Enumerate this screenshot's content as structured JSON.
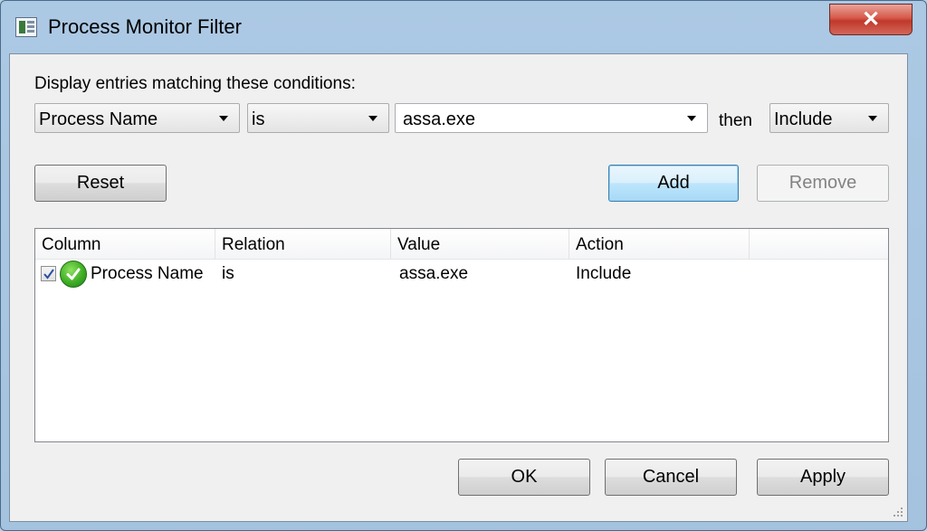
{
  "window": {
    "title": "Process Monitor Filter",
    "close_label": "✕"
  },
  "conditions": {
    "label": "Display entries matching these conditions:",
    "column_select": "Process Name",
    "relation_select": "is",
    "value_input": "assa.exe",
    "then_label": "then",
    "action_select": "Include"
  },
  "buttons": {
    "reset": "Reset",
    "add": "Add",
    "remove": "Remove",
    "ok": "OK",
    "cancel": "Cancel",
    "apply": "Apply"
  },
  "list": {
    "columns": [
      "Column",
      "Relation",
      "Value",
      "Action"
    ],
    "rows": [
      {
        "checked": true,
        "column": "Process Name",
        "relation": "is",
        "value": "assa.exe",
        "action": "Include"
      }
    ]
  },
  "colors": {
    "default_button_border": "#3c7fb1",
    "ok_icon_green": "#3fae25"
  },
  "icons": [
    "app-icon",
    "close-icon",
    "dropdown-arrow-icon",
    "checkmark-icon",
    "ok-status-icon"
  ]
}
